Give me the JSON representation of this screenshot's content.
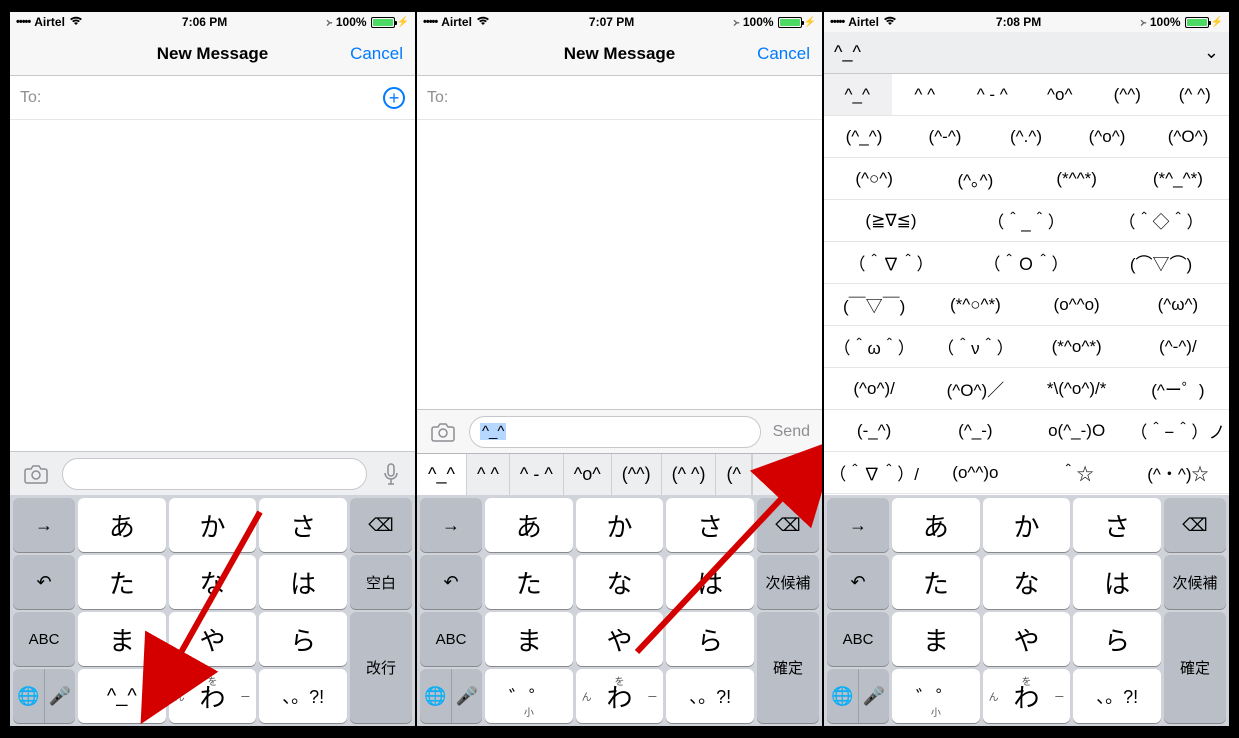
{
  "shots": [
    {
      "status": {
        "carrier": "Airtel",
        "signal": "•••••",
        "wifi": "✓",
        "time": "7:06 PM",
        "bt": "✱",
        "battery_pct": "100%"
      },
      "nav": {
        "title": "New Message",
        "cancel": "Cancel"
      },
      "to": {
        "label": "To:"
      },
      "keyboard": {
        "arrow": "→",
        "undo": "↶",
        "abc": "ABC",
        "globe": "🌐",
        "mic": "🎤",
        "backspace": "⌫",
        "space": "空白",
        "return": "改行",
        "kana": [
          [
            "あ",
            "か",
            "さ"
          ],
          [
            "た",
            "な",
            "は"
          ],
          [
            "ま",
            "や",
            "ら"
          ]
        ],
        "bottom_kana": [
          "^_^",
          "わ",
          "、。?!"
        ],
        "wa_deco": {
          "top": "を",
          "left": "ん",
          "right": "ー"
        }
      }
    },
    {
      "status": {
        "carrier": "Airtel",
        "signal": "•••••",
        "wifi": "✓",
        "time": "7:07 PM",
        "bt": "✱",
        "battery_pct": "100%"
      },
      "nav": {
        "title": "New Message",
        "cancel": "Cancel"
      },
      "to": {
        "label": "To:"
      },
      "input": {
        "value": "^_^",
        "send": "Send"
      },
      "suggestions": {
        "first": "^_^",
        "items": [
          "^ ^",
          "^ - ^",
          "^o^",
          "(^^)",
          "(^ ^)",
          "(^"
        ],
        "expand": "⌃"
      },
      "keyboard": {
        "arrow": "→",
        "undo": "↶",
        "abc": "ABC",
        "globe": "🌐",
        "mic": "🎤",
        "backspace": "⌫",
        "space": "次候補",
        "return": "確定",
        "kana": [
          [
            "あ",
            "か",
            "さ"
          ],
          [
            "た",
            "な",
            "は"
          ],
          [
            "ま",
            "や",
            "ら"
          ]
        ],
        "bottom_kana": [
          "゛゜",
          "わ",
          "、。?!"
        ],
        "bottom_deco": {
          "left_sub": "小"
        },
        "wa_deco": {
          "top": "を",
          "left": "ん",
          "right": "ー"
        }
      }
    },
    {
      "status": {
        "carrier": "Airtel",
        "signal": "•••••",
        "wifi": "✓",
        "time": "7:08 PM",
        "bt": "✱",
        "battery_pct": "100%"
      },
      "kaomoji": {
        "header": "^_^",
        "collapse": "⌄",
        "rows": [
          [
            "^_^",
            "^ ^",
            "^ - ^",
            "^o^",
            "(^^)",
            "(^ ^)"
          ],
          [
            "(^_^)",
            "(^-^)",
            "(^.^)",
            "(^o^)",
            "(^O^)"
          ],
          [
            "(^○^)",
            "(^｡^)",
            "(*^^*)",
            "(*^_^*)"
          ],
          [
            "(≧∇≦)",
            "（＾_＾）",
            "（＾◇＾）"
          ],
          [
            "（＾∇＾）",
            "（＾Ｏ＾）",
            "(⌒▽⌒)"
          ],
          [
            "(￣▽￣)",
            "(*^○^*)",
            "(o^^o)",
            "(^ω^)"
          ],
          [
            "（＾ω＾）",
            "（＾ν＾）",
            "(*^o^*)",
            "(^-^)/"
          ],
          [
            "(^o^)/",
            "(^O^)／",
            "*\\(^o^)/*",
            "(^ー゜)"
          ],
          [
            "(-_^)",
            "(^_-)",
            "o(^_-)O",
            "（＾−＾）ノ"
          ],
          [
            "（＾∇＾）/",
            "(o^^)o",
            "＾☆",
            "(^・^)☆"
          ]
        ]
      },
      "keyboard": {
        "arrow": "→",
        "undo": "↶",
        "abc": "ABC",
        "globe": "🌐",
        "mic": "🎤",
        "backspace": "⌫",
        "space": "次候補",
        "return": "確定",
        "kana": [
          [
            "あ",
            "か",
            "さ"
          ],
          [
            "た",
            "な",
            "は"
          ],
          [
            "ま",
            "や",
            "ら"
          ]
        ],
        "bottom_kana": [
          "゛゜",
          "わ",
          "、。?!"
        ],
        "bottom_deco": {
          "left_sub": "小"
        },
        "wa_deco": {
          "top": "を",
          "left": "ん",
          "right": "ー"
        }
      }
    }
  ]
}
